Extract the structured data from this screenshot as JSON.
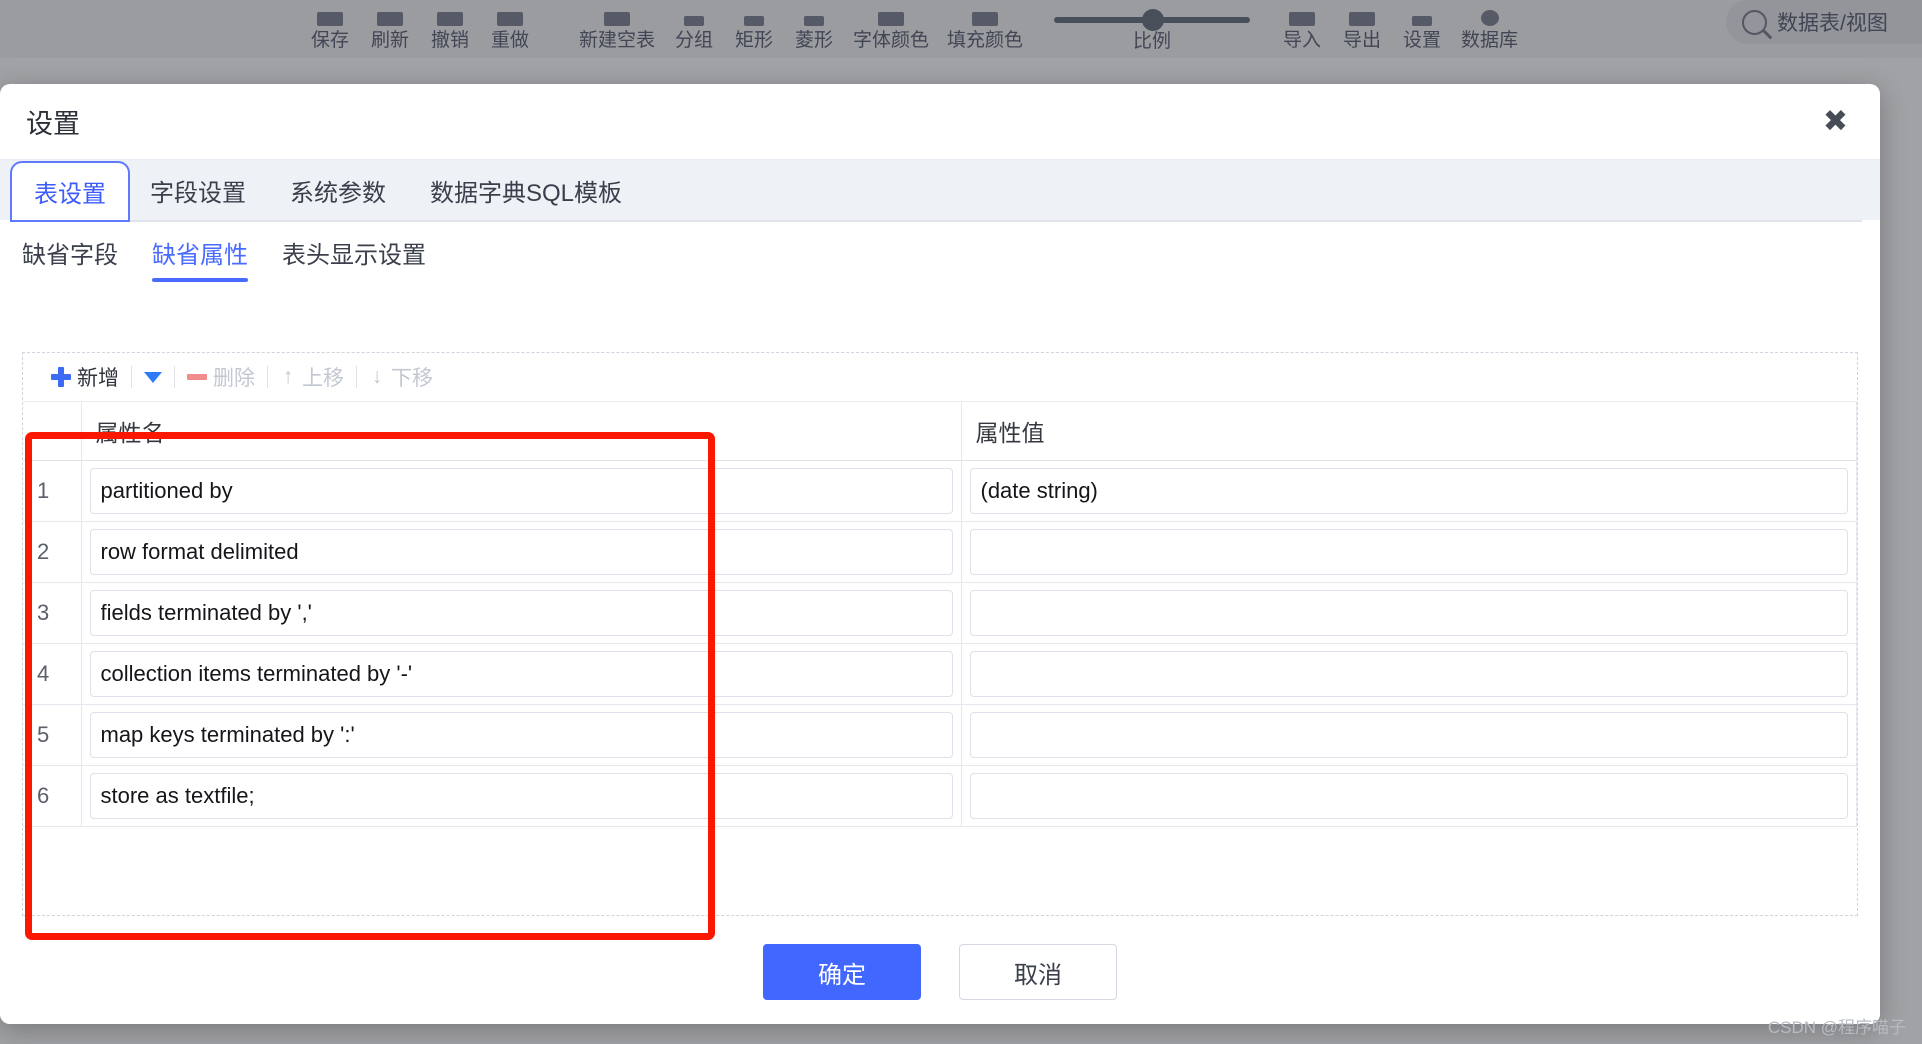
{
  "toolbar": {
    "items": [
      {
        "label": "保存",
        "icon": "save-icon"
      },
      {
        "label": "刷新",
        "icon": "refresh-icon"
      },
      {
        "label": "撤销",
        "icon": "undo-icon"
      },
      {
        "label": "重做",
        "icon": "redo-icon"
      },
      {
        "label": "新建空表",
        "icon": "new-table-icon"
      },
      {
        "label": "分组",
        "icon": "group-icon"
      },
      {
        "label": "矩形",
        "icon": "rectangle-icon"
      },
      {
        "label": "菱形",
        "icon": "diamond-icon"
      },
      {
        "label": "字体颜色",
        "icon": "font-color-icon"
      },
      {
        "label": "填充颜色",
        "icon": "fill-color-icon"
      }
    ],
    "slider_label": "比例",
    "right_items": [
      {
        "label": "导入",
        "icon": "import-icon"
      },
      {
        "label": "导出",
        "icon": "export-icon"
      },
      {
        "label": "设置",
        "icon": "settings-icon"
      },
      {
        "label": "数据库",
        "icon": "database-icon"
      }
    ],
    "search": {
      "icon": "search-icon",
      "value": "数据表/视图"
    }
  },
  "modal": {
    "title": "设置",
    "close_icon": "close-icon",
    "main_tabs": [
      {
        "label": "表设置",
        "active": true
      },
      {
        "label": "字段设置",
        "active": false
      },
      {
        "label": "系统参数",
        "active": false
      },
      {
        "label": "数据字典SQL模板",
        "active": false
      }
    ],
    "sub_tabs": [
      {
        "label": "缺省字段",
        "active": false
      },
      {
        "label": "缺省属性",
        "active": true
      },
      {
        "label": "表头显示设置",
        "active": false
      }
    ],
    "grid_toolbar": {
      "add": {
        "label": "新增",
        "icon": "plus-icon",
        "disabled": false
      },
      "add_dropdown": {
        "icon": "caret-down-icon",
        "disabled": false
      },
      "delete": {
        "label": "删除",
        "icon": "minus-icon",
        "disabled": true
      },
      "move_up": {
        "label": "上移",
        "icon": "arrow-up-icon",
        "disabled": true
      },
      "move_down": {
        "label": "下移",
        "icon": "arrow-down-icon",
        "disabled": true
      }
    },
    "table": {
      "headers": [
        "",
        "属性名",
        "属性值"
      ],
      "rows": [
        {
          "index": "1",
          "name": "partitioned by",
          "value": "(date string)"
        },
        {
          "index": "2",
          "name": "row format delimited",
          "value": ""
        },
        {
          "index": "3",
          "name": "fields terminated by ','",
          "value": ""
        },
        {
          "index": "4",
          "name": "collection items terminated by '-'",
          "value": ""
        },
        {
          "index": "5",
          "name": "map keys terminated by ':'",
          "value": ""
        },
        {
          "index": "6",
          "name": "store as textfile;",
          "value": ""
        }
      ]
    },
    "footer": {
      "confirm": "确定",
      "cancel": "取消"
    }
  },
  "annotation": {
    "color": "#fa1900"
  },
  "watermark": "CSDN @程序喵子",
  "colors": {
    "accent": "#4167ff",
    "tab_active": "#4a6bff",
    "annotation_red": "#fa1900",
    "toolbar_bg": "#f3f4f6"
  }
}
